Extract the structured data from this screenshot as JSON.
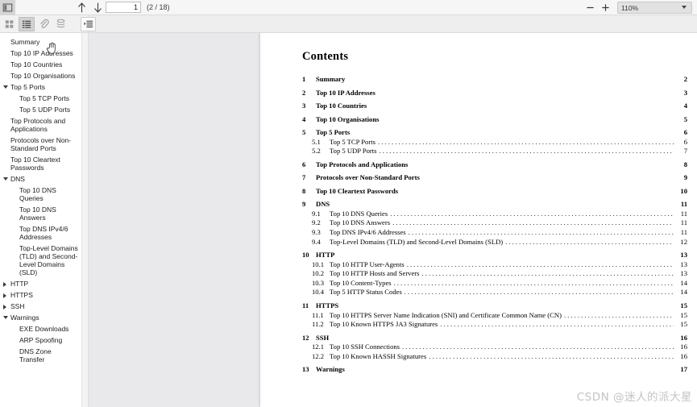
{
  "toolbar": {
    "sidebar_toggle_icon": "sidebar-panel-icon",
    "prev_page_icon": "arrow-up-icon",
    "next_page_icon": "arrow-down-icon",
    "page_number_value": "1",
    "page_total_label": "(2 / 18)",
    "zoom_out_label": "−",
    "zoom_in_label": "+",
    "zoom_level": "110%"
  },
  "sidebar_toolbar": {
    "thumbnails_icon": "thumbnails-grid-icon",
    "outline_icon": "document-outline-icon",
    "attachments_icon": "paperclip-icon",
    "layers_icon": "layers-stack-icon",
    "current_view_icon": "current-outline-item-icon"
  },
  "outline": {
    "items": [
      {
        "label": "Summary",
        "level": 1,
        "marker": "none"
      },
      {
        "label": "Top 10 IP Addresses",
        "level": 1,
        "marker": "none"
      },
      {
        "label": "Top 10 Countries",
        "level": 1,
        "marker": "none"
      },
      {
        "label": "Top 10 Organisations",
        "level": 1,
        "marker": "none"
      },
      {
        "label": "Top 5 Ports",
        "level": 1,
        "marker": "open"
      },
      {
        "label": "Top 5 TCP Ports",
        "level": 2,
        "marker": "none"
      },
      {
        "label": "Top 5 UDP Ports",
        "level": 2,
        "marker": "none"
      },
      {
        "label": "Top Protocols and Applications",
        "level": 1,
        "marker": "none"
      },
      {
        "label": "Protocols over Non-Standard Ports",
        "level": 1,
        "marker": "none"
      },
      {
        "label": "Top 10 Cleartext Passwords",
        "level": 1,
        "marker": "none"
      },
      {
        "label": "DNS",
        "level": 1,
        "marker": "open"
      },
      {
        "label": "Top 10 DNS Queries",
        "level": 2,
        "marker": "none"
      },
      {
        "label": "Top 10 DNS Answers",
        "level": 2,
        "marker": "none"
      },
      {
        "label": "Top DNS IPv4/6 Addresses",
        "level": 2,
        "marker": "none"
      },
      {
        "label": "Top-Level Domains (TLD) and Second-Level Domains (SLD)",
        "level": 2,
        "marker": "none"
      },
      {
        "label": "HTTP",
        "level": 1,
        "marker": "closed"
      },
      {
        "label": "HTTPS",
        "level": 1,
        "marker": "closed"
      },
      {
        "label": "SSH",
        "level": 1,
        "marker": "closed"
      },
      {
        "label": "Warnings",
        "level": 1,
        "marker": "open"
      },
      {
        "label": "EXE Downloads",
        "level": 2,
        "marker": "none"
      },
      {
        "label": "ARP Spoofing",
        "level": 2,
        "marker": "none"
      },
      {
        "label": "DNS Zone Transfer",
        "level": 2,
        "marker": "none"
      }
    ]
  },
  "document": {
    "title": "Contents",
    "toc": [
      {
        "num": "1",
        "label": "Summary",
        "page": "2",
        "level": 1,
        "dots": false
      },
      {
        "num": "2",
        "label": "Top 10 IP Addresses",
        "page": "3",
        "level": 1,
        "dots": false
      },
      {
        "num": "3",
        "label": "Top 10 Countries",
        "page": "4",
        "level": 1,
        "dots": false
      },
      {
        "num": "4",
        "label": "Top 10 Organisations",
        "page": "5",
        "level": 1,
        "dots": false
      },
      {
        "num": "5",
        "label": "Top 5 Ports",
        "page": "6",
        "level": 1,
        "dots": false
      },
      {
        "num": "5.1",
        "label": "Top 5 TCP Ports",
        "page": "6",
        "level": 2,
        "dots": true
      },
      {
        "num": "5.2",
        "label": "Top 5 UDP Ports",
        "page": "7",
        "level": 2,
        "dots": true
      },
      {
        "num": "6",
        "label": "Top Protocols and Applications",
        "page": "8",
        "level": 1,
        "dots": false
      },
      {
        "num": "7",
        "label": "Protocols over Non-Standard Ports",
        "page": "9",
        "level": 1,
        "dots": false
      },
      {
        "num": "8",
        "label": "Top 10 Cleartext Passwords",
        "page": "10",
        "level": 1,
        "dots": false
      },
      {
        "num": "9",
        "label": "DNS",
        "page": "11",
        "level": 1,
        "dots": false
      },
      {
        "num": "9.1",
        "label": "Top 10 DNS Queries",
        "page": "11",
        "level": 2,
        "dots": true
      },
      {
        "num": "9.2",
        "label": "Top 10 DNS Answers",
        "page": "11",
        "level": 2,
        "dots": true
      },
      {
        "num": "9.3",
        "label": "Top DNS IPv4/6 Addresses",
        "page": "11",
        "level": 2,
        "dots": true
      },
      {
        "num": "9.4",
        "label": "Top-Level Domains (TLD) and Second-Level Domains (SLD)",
        "page": "12",
        "level": 2,
        "dots": true
      },
      {
        "num": "10",
        "label": "HTTP",
        "page": "13",
        "level": 1,
        "dots": false
      },
      {
        "num": "10.1",
        "label": "Top 10 HTTP User-Agents",
        "page": "13",
        "level": 2,
        "dots": true
      },
      {
        "num": "10.2",
        "label": "Top 10 HTTP Hosts and Servers",
        "page": "13",
        "level": 2,
        "dots": true
      },
      {
        "num": "10.3",
        "label": "Top 10 Content-Types",
        "page": "14",
        "level": 2,
        "dots": true
      },
      {
        "num": "10.4",
        "label": "Top 5 HTTP Status Codes",
        "page": "14",
        "level": 2,
        "dots": true
      },
      {
        "num": "11",
        "label": "HTTPS",
        "page": "15",
        "level": 1,
        "dots": false
      },
      {
        "num": "11.1",
        "label": "Top 10 HTTPS Server Name Indication (SNI) and Certificate Common Name (CN)",
        "page": "15",
        "level": 2,
        "dots": true
      },
      {
        "num": "11.2",
        "label": "Top 10 Known HTTPS JA3 Signatures",
        "page": "15",
        "level": 2,
        "dots": true
      },
      {
        "num": "12",
        "label": "SSH",
        "page": "16",
        "level": 1,
        "dots": false
      },
      {
        "num": "12.1",
        "label": "Top 10 SSH Connections",
        "page": "16",
        "level": 2,
        "dots": true
      },
      {
        "num": "12.2",
        "label": "Top 10 Known HASSH Signatures",
        "page": "16",
        "level": 2,
        "dots": true
      },
      {
        "num": "13",
        "label": "Warnings",
        "page": "17",
        "level": 1,
        "dots": false
      }
    ]
  },
  "watermark": {
    "text": "CSDN @迷人的派大星"
  },
  "colors": {
    "toolbar_bg": "#f6f6f6",
    "viewer_bg": "#e9e9eb",
    "page_bg": "#ffffff",
    "text": "#1c1c1c",
    "watermark": "#c3c3c3"
  }
}
